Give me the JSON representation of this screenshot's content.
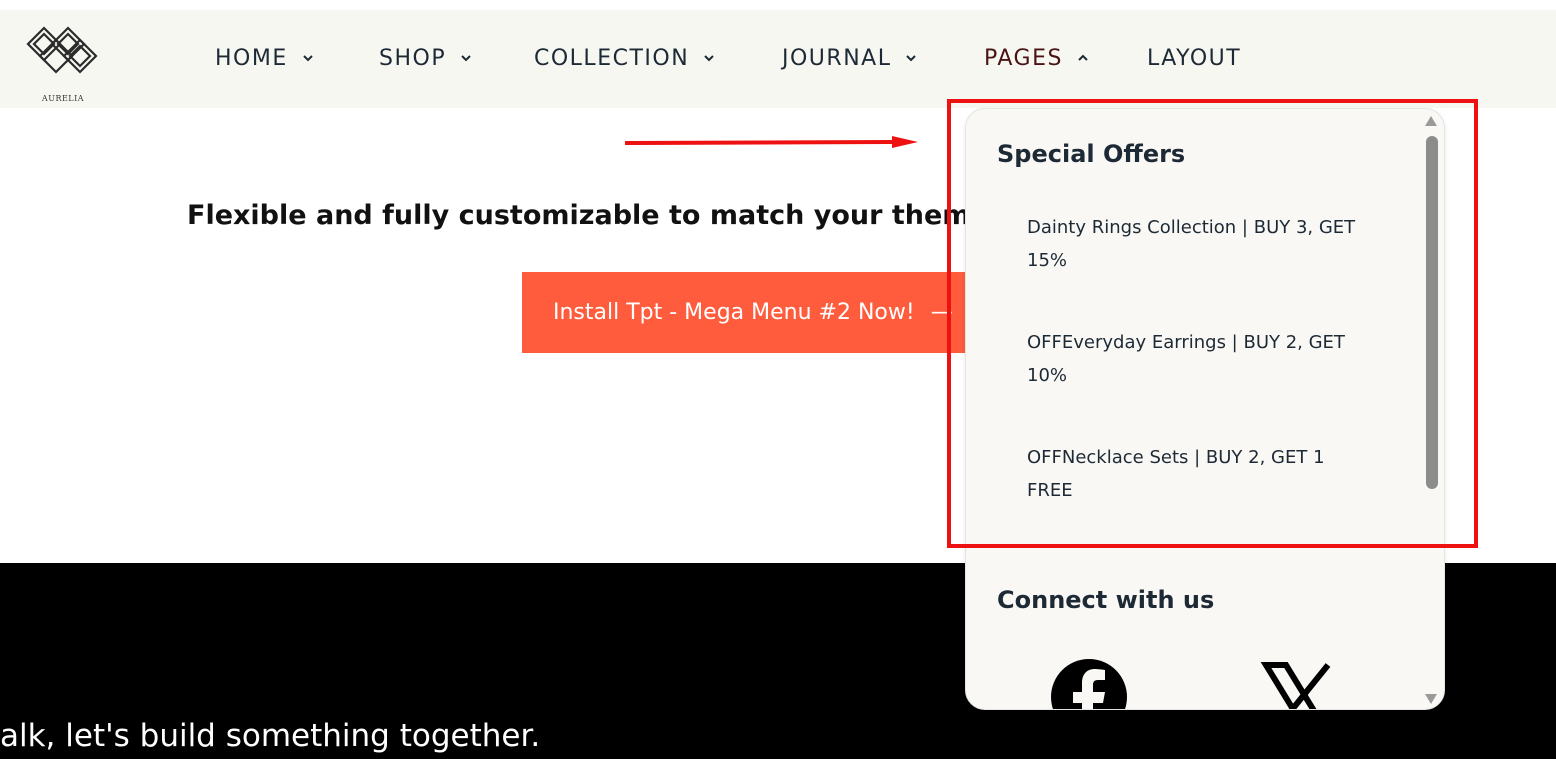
{
  "brand": {
    "logo_text": "AURELIA"
  },
  "nav": {
    "items": [
      {
        "label": "HOME"
      },
      {
        "label": "SHOP"
      },
      {
        "label": "COLLECTION"
      },
      {
        "label": "JOURNAL"
      },
      {
        "label": "PAGES"
      },
      {
        "label": "LAYOUT"
      }
    ]
  },
  "hero": {
    "tagline": "Flexible and fully customizable to match your theme",
    "button_label": "Install Tpt - Mega Menu #2 Now!",
    "button_suffix": "—"
  },
  "footer_band": {
    "text": "alk, let's build something together."
  },
  "dropdown": {
    "special_offers_title": "Special Offers",
    "offers": [
      "Dainty Rings Collection | BUY 3, GET 15%",
      "OFFEveryday Earrings | BUY 2, GET 10%",
      "OFFNecklace Sets | BUY 2, GET 1 FREE"
    ],
    "connect_title": "Connect with us",
    "social_icons": [
      "facebook-icon",
      "x-icon"
    ]
  },
  "colors": {
    "header_bg": "#f7f7f2",
    "button_bg": "#fe5c3d",
    "highlight": "#ee1111",
    "active_nav": "#4a1414"
  }
}
